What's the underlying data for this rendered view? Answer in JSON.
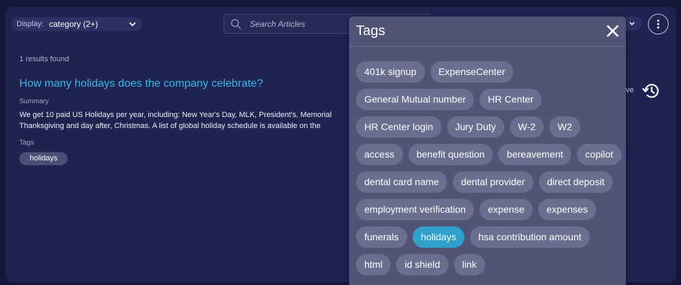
{
  "display": {
    "label": "Display:",
    "value": "category (2+)"
  },
  "search": {
    "placeholder": "Search Articles"
  },
  "results": {
    "count_text": "1 results found",
    "article": {
      "title": "How many holidays does the company celebrate?",
      "summary_label": "Summary",
      "summary_line1": "We get 10 paid US Holidays per year, including: New Year's Day, MLK, President's, Memorial",
      "summary_line2": "Thanksgiving and day after, Christmas. A list of global holiday schedule is available on the",
      "tags_label": "Tags",
      "tag": "holidays"
    }
  },
  "history": {
    "label_partial": "ve"
  },
  "tags_panel": {
    "title": "Tags",
    "selected_color": "#2fa0cc",
    "tags": [
      {
        "label": "401k signup",
        "selected": false
      },
      {
        "label": "ExpenseCenter",
        "selected": false
      },
      {
        "label": "General Mutual number",
        "selected": false
      },
      {
        "label": "HR Center",
        "selected": false
      },
      {
        "label": "HR Center login",
        "selected": false
      },
      {
        "label": "Jury Duty",
        "selected": false
      },
      {
        "label": "W-2",
        "selected": false
      },
      {
        "label": "W2",
        "selected": false
      },
      {
        "label": "access",
        "selected": false
      },
      {
        "label": "benefit question",
        "selected": false
      },
      {
        "label": "bereavement",
        "selected": false
      },
      {
        "label": "copilot",
        "selected": false
      },
      {
        "label": "dental card name",
        "selected": false
      },
      {
        "label": "dental provider",
        "selected": false
      },
      {
        "label": "direct deposit",
        "selected": false
      },
      {
        "label": "employment verification",
        "selected": false
      },
      {
        "label": "expense",
        "selected": false
      },
      {
        "label": "expenses",
        "selected": false
      },
      {
        "label": "funerals",
        "selected": false
      },
      {
        "label": "holidays",
        "selected": true
      },
      {
        "label": "hsa contribution amount",
        "selected": false
      },
      {
        "label": "html",
        "selected": false
      },
      {
        "label": "id shield",
        "selected": false
      },
      {
        "label": "link",
        "selected": false
      }
    ]
  }
}
